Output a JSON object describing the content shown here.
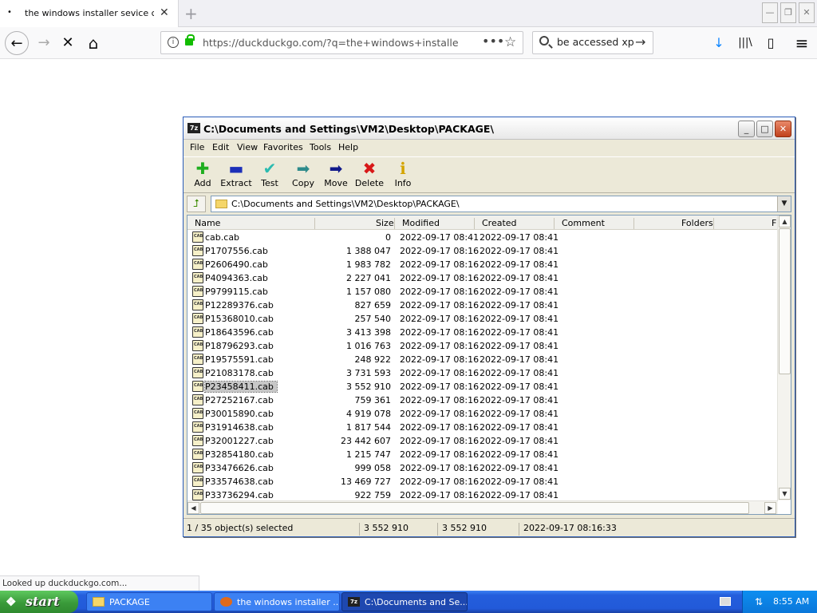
{
  "browser": {
    "tab_title": "the windows installer sevice could",
    "tab_dot": "•",
    "tab_close": "✕",
    "new_tab": "+",
    "url": "https://duckduckgo.com/?q=the+windows+installer+se",
    "page_actions": "•••",
    "bookmark_star": "☆",
    "search_value": "be accessed xp",
    "search_go": "→",
    "back": "←",
    "forward": "→",
    "stop": "✕",
    "home": "⌂",
    "download": "↓",
    "library": "|||\\",
    "sidebar": "▯",
    "menu": "≡",
    "status_text": "Looked up duckduckgo.com...",
    "win_controls": {
      "minimize": "—",
      "restore": "❐",
      "close": "✕"
    }
  },
  "zip_window": {
    "title": "C:\\Documents and Settings\\VM2\\Desktop\\PACKAGE\\",
    "app_icon_text": "7z",
    "controls": {
      "minimize": "_",
      "maximize": "□",
      "close": "✕"
    },
    "menu": [
      "File",
      "Edit",
      "View",
      "Favorites",
      "Tools",
      "Help"
    ],
    "toolbar": [
      {
        "label": "Add",
        "glyph": "✚",
        "color": "#1fae1f"
      },
      {
        "label": "Extract",
        "glyph": "▬",
        "color": "#1c2fb8"
      },
      {
        "label": "Test",
        "glyph": "✔",
        "color": "#2bbbb0"
      },
      {
        "label": "Copy",
        "glyph": "➡",
        "color": "#2e8b8b"
      },
      {
        "label": "Move",
        "glyph": "➡",
        "color": "#10198a"
      },
      {
        "label": "Delete",
        "glyph": "✖",
        "color": "#d81818"
      },
      {
        "label": "Info",
        "glyph": "ℹ",
        "color": "#d4a400"
      }
    ],
    "address": "C:\\Documents and Settings\\VM2\\Desktop\\PACKAGE\\",
    "columns": {
      "name": "Name",
      "size": "Size",
      "modified": "Modified",
      "created": "Created",
      "comment": "Comment",
      "folders": "Folders",
      "files": "F"
    },
    "rows": [
      {
        "name": "cab.cab",
        "size": "0",
        "modified": "2022-09-17 08:41",
        "created": "2022-09-17 08:41"
      },
      {
        "name": "P1707556.cab",
        "size": "1 388 047",
        "modified": "2022-09-17 08:16",
        "created": "2022-09-17 08:41"
      },
      {
        "name": "P2606490.cab",
        "size": "1 983 782",
        "modified": "2022-09-17 08:16",
        "created": "2022-09-17 08:41"
      },
      {
        "name": "P4094363.cab",
        "size": "2 227 041",
        "modified": "2022-09-17 08:16",
        "created": "2022-09-17 08:41"
      },
      {
        "name": "P9799115.cab",
        "size": "1 157 080",
        "modified": "2022-09-17 08:16",
        "created": "2022-09-17 08:41"
      },
      {
        "name": "P12289376.cab",
        "size": "827 659",
        "modified": "2022-09-17 08:16",
        "created": "2022-09-17 08:41"
      },
      {
        "name": "P15368010.cab",
        "size": "257 540",
        "modified": "2022-09-17 08:16",
        "created": "2022-09-17 08:41"
      },
      {
        "name": "P18643596.cab",
        "size": "3 413 398",
        "modified": "2022-09-17 08:16",
        "created": "2022-09-17 08:41"
      },
      {
        "name": "P18796293.cab",
        "size": "1 016 763",
        "modified": "2022-09-17 08:16",
        "created": "2022-09-17 08:41"
      },
      {
        "name": "P19575591.cab",
        "size": "248 922",
        "modified": "2022-09-17 08:16",
        "created": "2022-09-17 08:41"
      },
      {
        "name": "P21083178.cab",
        "size": "3 731 593",
        "modified": "2022-09-17 08:16",
        "created": "2022-09-17 08:41"
      },
      {
        "name": "P23458411.cab",
        "size": "3 552 910",
        "modified": "2022-09-17 08:16",
        "created": "2022-09-17 08:41",
        "selected": true
      },
      {
        "name": "P27252167.cab",
        "size": "759 361",
        "modified": "2022-09-17 08:16",
        "created": "2022-09-17 08:41"
      },
      {
        "name": "P30015890.cab",
        "size": "4 919 078",
        "modified": "2022-09-17 08:16",
        "created": "2022-09-17 08:41"
      },
      {
        "name": "P31914638.cab",
        "size": "1 817 544",
        "modified": "2022-09-17 08:16",
        "created": "2022-09-17 08:41"
      },
      {
        "name": "P32001227.cab",
        "size": "23 442 607",
        "modified": "2022-09-17 08:16",
        "created": "2022-09-17 08:41"
      },
      {
        "name": "P32854180.cab",
        "size": "1 215 747",
        "modified": "2022-09-17 08:16",
        "created": "2022-09-17 08:41"
      },
      {
        "name": "P33476626.cab",
        "size": "999 058",
        "modified": "2022-09-17 08:16",
        "created": "2022-09-17 08:41"
      },
      {
        "name": "P33574638.cab",
        "size": "13 469 727",
        "modified": "2022-09-17 08:16",
        "created": "2022-09-17 08:41"
      },
      {
        "name": "P33736294.cab",
        "size": "922 759",
        "modified": "2022-09-17 08:16",
        "created": "2022-09-17 08:41"
      }
    ],
    "status": {
      "selection": "1 / 35 object(s) selected",
      "size": "3 552 910",
      "packed": "3 552 910",
      "modified": "2022-09-17 08:16:33"
    },
    "scroll": {
      "up": "▲",
      "down": "▼",
      "left": "◀",
      "right": "▶"
    }
  },
  "taskbar": {
    "start_label": "start",
    "tasks": [
      {
        "label": "PACKAGE",
        "icon": "folder"
      },
      {
        "label": "the windows installer ...",
        "icon": "firefox"
      },
      {
        "label": "C:\\Documents and Se...",
        "icon": "7zip",
        "active": true
      }
    ],
    "clock": "8:55 AM"
  }
}
